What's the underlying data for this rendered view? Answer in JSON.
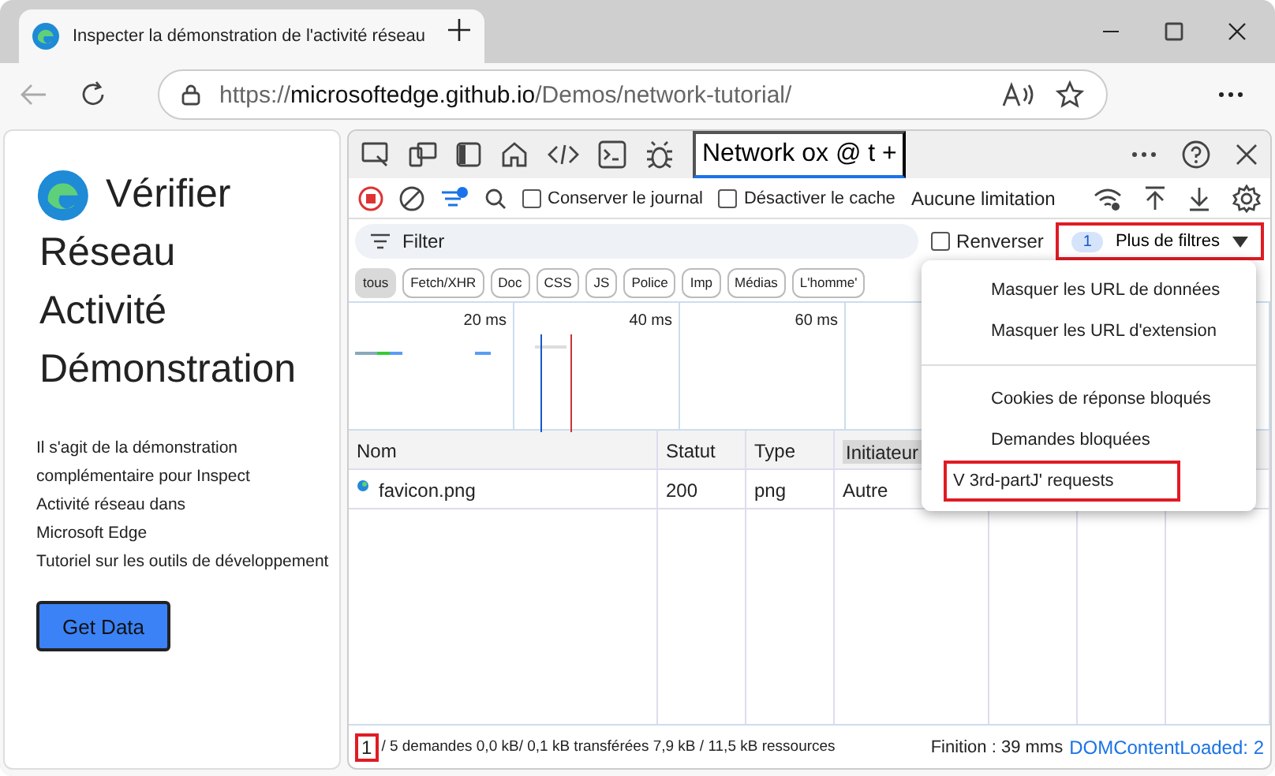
{
  "browser": {
    "tab_title": "Inspecter la démonstration de l'activité réseau",
    "url": [
      {
        "text": "https://",
        "kind": "dim"
      },
      {
        "text": "microsoftedge.github.io",
        "kind": "host"
      },
      {
        "text": "/Demos/network-tutorial/",
        "kind": "dim"
      }
    ]
  },
  "page": {
    "heading": [
      "Vérifier",
      "Réseau",
      "Activité",
      "Démonstration"
    ],
    "description": [
      "Il s'agit de la démonstration",
      "complémentaire pour Inspect",
      "Activité réseau dans",
      "Microsoft Edge",
      "Tutoriel sur les outils de développement"
    ],
    "button": "Get Data"
  },
  "devtools": {
    "tab_label": "Network ox @ t +",
    "tab_selected": true,
    "toolbar": {
      "recording": true,
      "checkboxes": [
        {
          "label": "Conserver le journal",
          "checked": false
        },
        {
          "label": "Désactiver le cache",
          "checked": false
        }
      ],
      "throttling": "Aucune limitation"
    },
    "filter": {
      "placeholder": "Filter",
      "invert": {
        "label": "Renverser",
        "checked": false
      },
      "more_filters": {
        "count": "1",
        "label": "Plus de filtres",
        "highlighted": true
      }
    },
    "chips": [
      {
        "label": "tous",
        "selected": true
      },
      {
        "label": "Fetch/XHR",
        "selected": false
      },
      {
        "label": "Doc",
        "selected": false
      },
      {
        "label": "CSS",
        "selected": false
      },
      {
        "label": "JS",
        "selected": false
      },
      {
        "label": "Police",
        "selected": false
      },
      {
        "label": "Imp",
        "selected": false
      },
      {
        "label": "Médias",
        "selected": false
      },
      {
        "label": "L'homme'",
        "selected": false
      }
    ],
    "overview_ticks": [
      "20 ms",
      "40 ms",
      "60 ms"
    ],
    "table": {
      "columns": [
        "Nom",
        "Statut",
        "Type",
        "Initiateur"
      ],
      "rows": [
        [
          "favicon.png",
          "200",
          "png",
          "Autre"
        ]
      ]
    },
    "menu": [
      {
        "kind": "item",
        "label": "Masquer les URL de données",
        "highlighted": false
      },
      {
        "kind": "item",
        "label": "Masquer les URL d'extension",
        "highlighted": false
      },
      {
        "kind": "separator"
      },
      {
        "kind": "item",
        "label": "Cookies de réponse bloqués",
        "highlighted": false
      },
      {
        "kind": "item",
        "label": "Demandes bloquées",
        "highlighted": false
      },
      {
        "kind": "item",
        "label": "V 3rd-partJ' requests",
        "highlighted": true
      }
    ],
    "status_bar": {
      "count": "1",
      "count_highlighted": true,
      "summary": "/ 5 demandes 0,0 kB/ 0,1 kB transférées 7,9 kB / 11,5 kB ressources",
      "finish": "Finition : 39 mms",
      "dom_loaded": "DOMContentLoaded: 2"
    }
  }
}
